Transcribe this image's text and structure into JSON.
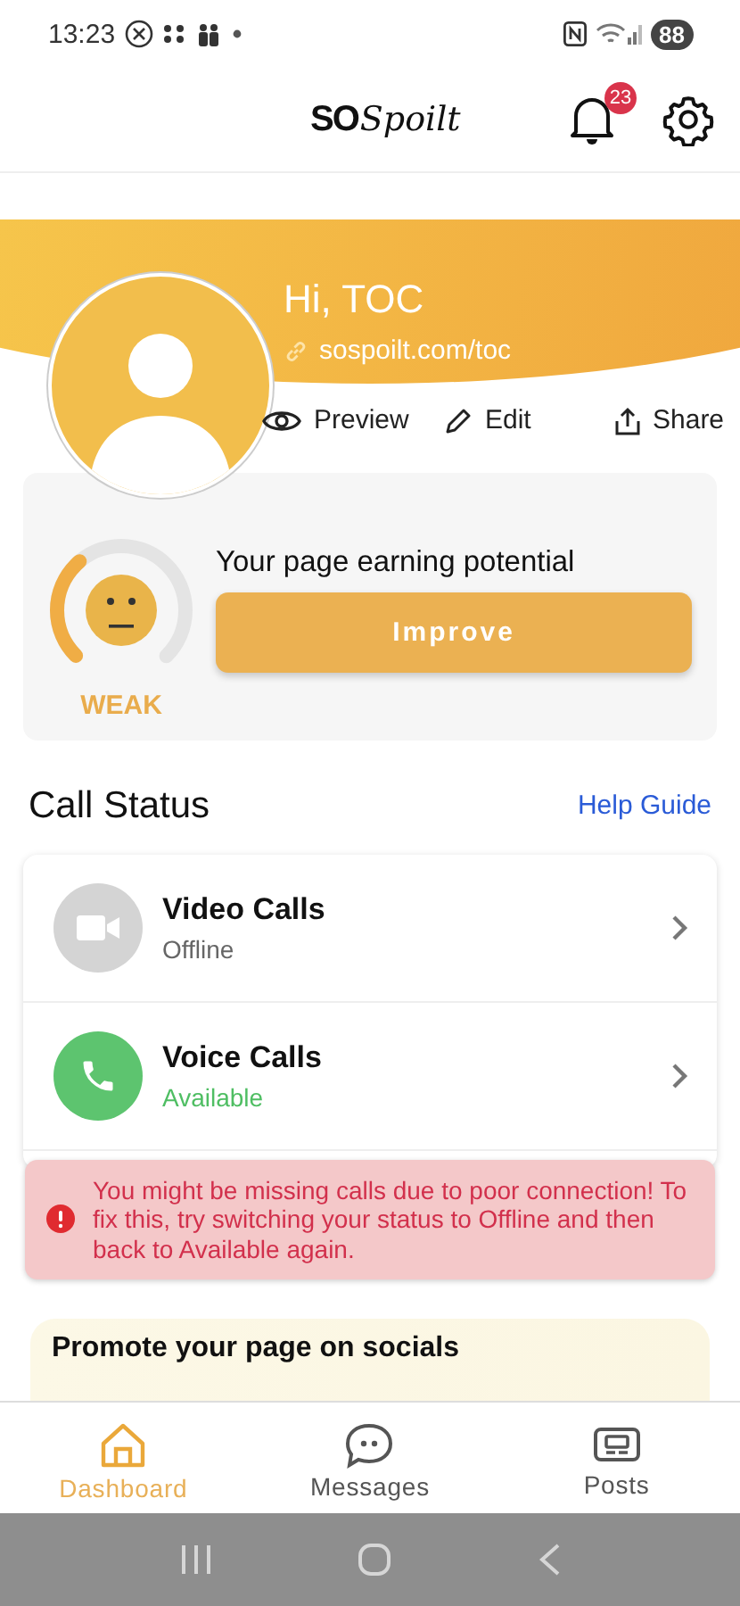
{
  "status_bar": {
    "time": "13:23",
    "battery": "88"
  },
  "header": {
    "logo_bold": "SO",
    "logo_script": "Spoilt",
    "notification_count": "23"
  },
  "profile": {
    "greeting": "Hi, TOC",
    "link": "sospoilt.com/toc",
    "actions": [
      {
        "kind": "preview",
        "label": "Preview"
      },
      {
        "kind": "edit",
        "label": "Edit"
      },
      {
        "kind": "share",
        "label": "Share"
      }
    ]
  },
  "earning": {
    "title": "Your page earning potential",
    "level": 0.35,
    "rating": "WEAK",
    "button": "Improve"
  },
  "call_status": {
    "title": "Call Status",
    "help_link": "Help Guide",
    "items": [
      {
        "kind": "video",
        "name": "Video Calls",
        "status": "Offline",
        "available": false
      },
      {
        "kind": "voice",
        "name": "Voice Calls",
        "status": "Available",
        "available": true
      }
    ]
  },
  "alert": {
    "message": "You might be missing calls due to poor connection! To fix this, try switching your status to Offline and then back to Available again."
  },
  "promote": {
    "title": "Promote your page on socials"
  },
  "bottom_nav": [
    {
      "kind": "home",
      "label": "Dashboard",
      "selected": true
    },
    {
      "kind": "messages",
      "label": "Messages",
      "selected": false
    },
    {
      "kind": "posts",
      "label": "Posts",
      "selected": false
    }
  ]
}
